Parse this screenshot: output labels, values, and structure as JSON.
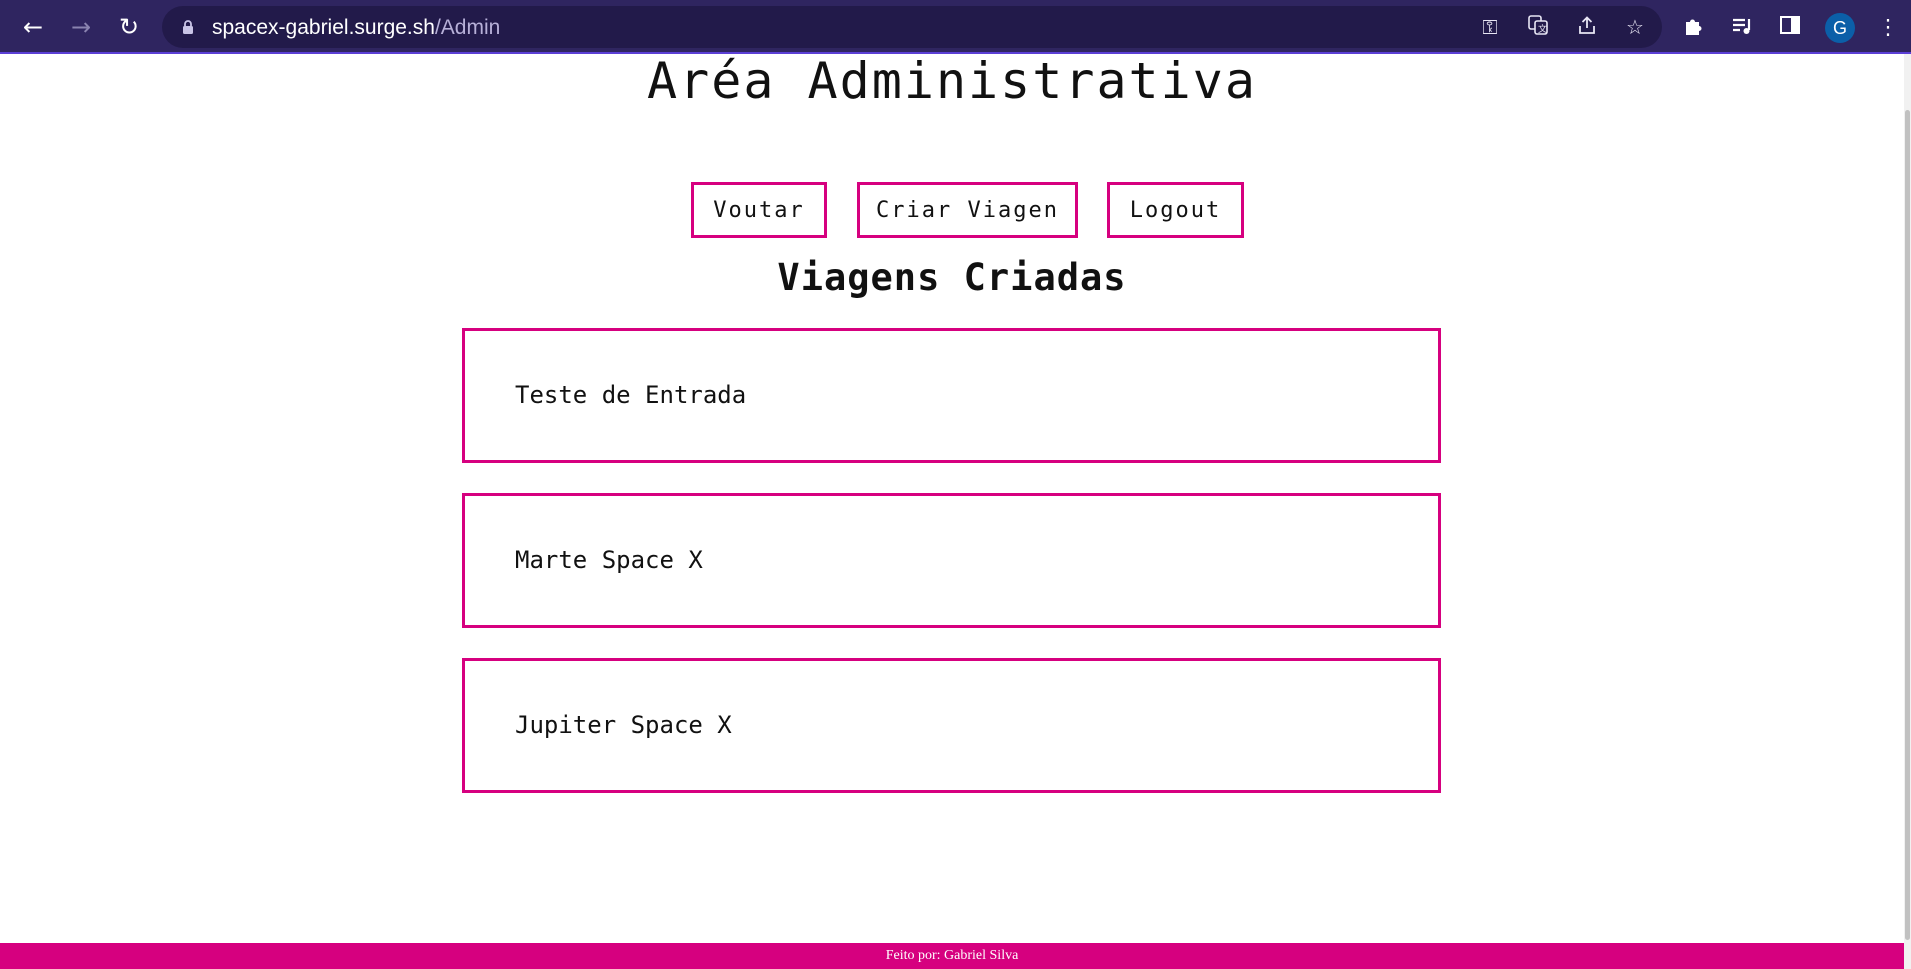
{
  "browser": {
    "url_host": "spacex-gabriel.surge.sh",
    "url_path": "/Admin",
    "avatar_letter": "G",
    "icons": [
      "back-arrow-icon",
      "forward-arrow-icon",
      "reload-icon",
      "lock-icon",
      "key-icon",
      "translate-icon",
      "share-icon",
      "star-icon",
      "extensions-puzzle-icon",
      "media-queue-icon",
      "side-panel-icon",
      "menu-dots-icon"
    ],
    "accent": "#2f2560"
  },
  "page": {
    "title": "Aréa Administrativa",
    "buttons": {
      "back": "Voutar",
      "create": "Criar Viagen",
      "logout": "Logout"
    },
    "section_title": "Viagens Criadas",
    "trips": [
      {
        "name": "Teste de Entrada"
      },
      {
        "name": "Marte Space X"
      },
      {
        "name": "Jupiter Space X"
      }
    ],
    "footer": "Feito por: Gabriel Silva",
    "accent_color": "#d6007f"
  }
}
